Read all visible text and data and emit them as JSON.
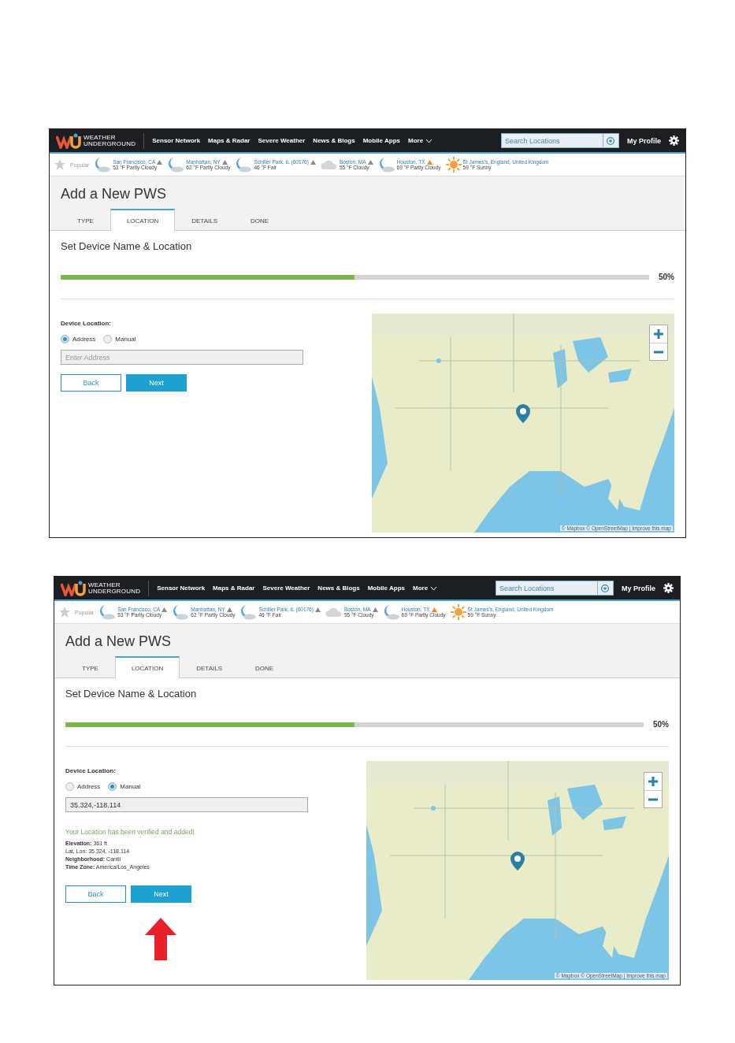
{
  "screenshots": [
    {
      "logo": [
        "WEATHER",
        "UNDERGROUND"
      ],
      "nav": [
        "Sensor Network",
        "Maps & Radar",
        "Severe Weather",
        "News & Blogs",
        "Mobile Apps",
        "More"
      ],
      "search": {
        "placeholder": "Search Locations"
      },
      "profile": "My Profile",
      "popular_label": "Popular",
      "cities": [
        {
          "name": "San Francisco, CA",
          "conditions": "53 °F Partly Cloudy",
          "kind": "night",
          "color": "#8a8a8a"
        },
        {
          "name": "Manhattan, NY",
          "conditions": "62 °F Partly Cloudy",
          "kind": "night",
          "color": "#8a8a8a"
        },
        {
          "name": "Schiller Park, IL (60176)",
          "conditions": "46 °F Fair",
          "kind": "night",
          "color": "#8a8a8a"
        },
        {
          "name": "Boston, MA",
          "conditions": "55 °F Cloudy",
          "kind": "cloud",
          "color": "#8a8a8a"
        },
        {
          "name": "Houston, TX",
          "conditions": "69 °F Partly Cloudy",
          "kind": "night",
          "color": "#f08a24"
        },
        {
          "name": "St James's, England, United Kingdom",
          "conditions": "59 °F Sunny",
          "kind": "sun"
        }
      ],
      "title": "Add a New PWS",
      "tabs": [
        {
          "label": "TYPE",
          "selected": false
        },
        {
          "label": "LOCATION",
          "selected": true
        },
        {
          "label": "DETAILS",
          "selected": false
        },
        {
          "label": "DONE",
          "selected": false
        }
      ],
      "section_title": "Set Device Name & Location",
      "progress": {
        "level": 0.5,
        "reading": "50%"
      },
      "device_location_label": "Device Location:",
      "radios": [
        {
          "label": "Address",
          "selected": true
        },
        {
          "label": "Manual",
          "selected": false
        }
      ],
      "location_field": {
        "placeholder": "Enter Address"
      },
      "buttons": [
        "Back",
        "Next"
      ],
      "map_attribution": "© Mapbox © OpenStreetMap | Improve this map"
    },
    {
      "logo": [
        "WEATHER",
        "UNDERGROUND"
      ],
      "nav": [
        "Sensor Network",
        "Maps & Radar",
        "Severe Weather",
        "News & Blogs",
        "Mobile Apps",
        "More"
      ],
      "search": {
        "placeholder": "Search Locations"
      },
      "profile": "My Profile",
      "popular_label": "Popular",
      "cities": [
        {
          "name": "San Francisco, CA",
          "conditions": "53 °F Partly Cloudy",
          "kind": "night",
          "color": "#8a8a8a"
        },
        {
          "name": "Manhattan, NY",
          "conditions": "62 °F Partly Cloudy",
          "kind": "night",
          "color": "#8a8a8a"
        },
        {
          "name": "Schiller Park, IL (60176)",
          "conditions": "46 °F Fair",
          "kind": "night",
          "color": "#8a8a8a"
        },
        {
          "name": "Boston, MA",
          "conditions": "55 °F Cloudy",
          "kind": "cloud",
          "color": "#8a8a8a"
        },
        {
          "name": "Houston, TX",
          "conditions": "69 °F Partly Cloudy",
          "kind": "night",
          "color": "#f08a24"
        },
        {
          "name": "St James's, England, United Kingdom",
          "conditions": "59 °F Sunny",
          "kind": "sun"
        }
      ],
      "title": "Add a New PWS",
      "tabs": [
        {
          "label": "TYPE",
          "selected": false
        },
        {
          "label": "LOCATION",
          "selected": true
        },
        {
          "label": "DETAILS",
          "selected": false
        },
        {
          "label": "DONE",
          "selected": false
        }
      ],
      "section_title": "Set Device Name & Location",
      "progress": {
        "level": 0.5,
        "reading": "50%"
      },
      "device_location_label": "Device Location:",
      "radios": [
        {
          "label": "Address",
          "selected": false
        },
        {
          "label": "Manual",
          "selected": true
        }
      ],
      "location_field": {
        "value": "35.324,-118.114"
      },
      "message": "Your Location has been verified and added!",
      "details": [
        "**Elevation:** 361 ft",
        "Lat, Lon: 35.324, -118.114",
        "**Neighborhood:** Cantil",
        "**Time Zone:** America/Los_Angeles"
      ],
      "buttons": [
        "Back",
        "Next"
      ],
      "map_attribution": "© Mapbox © OpenStreetMap | Improve this map",
      "pointer_arrow": true
    }
  ]
}
